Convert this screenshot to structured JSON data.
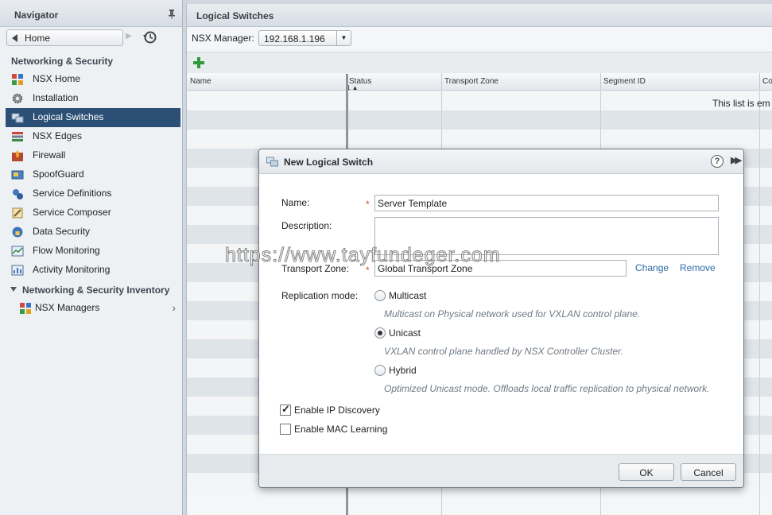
{
  "navigator": {
    "title": "Navigator",
    "home_label": "Home",
    "section_title": "Networking & Security",
    "items": [
      {
        "label": "NSX Home",
        "icon": "nsx-home-icon"
      },
      {
        "label": "Installation",
        "icon": "installation-gear-icon"
      },
      {
        "label": "Logical Switches",
        "icon": "logical-switch-icon",
        "selected": true
      },
      {
        "label": "NSX Edges",
        "icon": "nsx-edge-icon"
      },
      {
        "label": "Firewall",
        "icon": "firewall-icon"
      },
      {
        "label": "SpoofGuard",
        "icon": "spoofguard-icon"
      },
      {
        "label": "Service Definitions",
        "icon": "service-definitions-icon"
      },
      {
        "label": "Service Composer",
        "icon": "service-composer-icon"
      },
      {
        "label": "Data Security",
        "icon": "data-security-icon"
      },
      {
        "label": "Flow Monitoring",
        "icon": "flow-monitoring-icon"
      },
      {
        "label": "Activity Monitoring",
        "icon": "activity-monitoring-icon"
      }
    ],
    "inventory_title": "Networking & Security Inventory",
    "inventory_items": [
      {
        "label": "NSX Managers",
        "icon": "nsx-managers-icon"
      }
    ]
  },
  "main": {
    "title": "Logical Switches",
    "manager_label": "NSX Manager:",
    "manager_value": "192.168.1.196",
    "columns": [
      "Name",
      "Status",
      "Transport Zone",
      "Segment ID",
      "Co"
    ],
    "sort_indicator": "1 ▲",
    "empty_message": "This list is em"
  },
  "dialog": {
    "title": "New Logical Switch",
    "name_label": "Name:",
    "name_value": "Server Template",
    "description_label": "Description:",
    "description_value": "",
    "transport_zone_label": "Transport Zone:",
    "transport_zone_value": "Global Transport Zone",
    "change_link": "Change",
    "remove_link": "Remove",
    "replication_label": "Replication mode:",
    "replication_options": [
      {
        "label": "Multicast",
        "hint": "Multicast on Physical network used for VXLAN control plane.",
        "checked": false
      },
      {
        "label": "Unicast",
        "hint": "VXLAN control plane handled by NSX Controller Cluster.",
        "checked": true
      },
      {
        "label": "Hybrid",
        "hint": "Optimized Unicast mode. Offloads local traffic replication to physical network.",
        "checked": false
      }
    ],
    "enable_ip_discovery": {
      "label": "Enable IP Discovery",
      "checked": true
    },
    "enable_mac_learning": {
      "label": "Enable MAC Learning",
      "checked": false
    },
    "ok_label": "OK",
    "cancel_label": "Cancel",
    "help_glyph": "?"
  },
  "watermark": "https://www.tayfundeger.com",
  "colors": {
    "selected_nav": "#2c5075",
    "link": "#2b6aa6",
    "required": "#d9452b",
    "add_icon": "#2e9a3a"
  }
}
